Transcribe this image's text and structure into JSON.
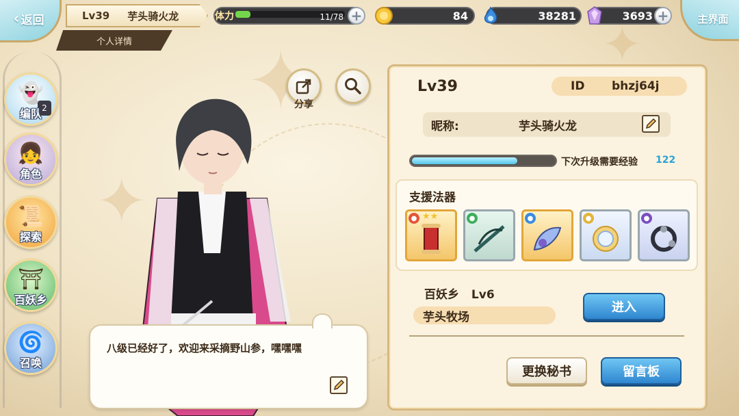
{
  "header": {
    "back_label": "返回",
    "level": "Lv39",
    "player_name": "芋头骑火龙",
    "detail_tab": "个人详情",
    "stamina_label": "体力",
    "stamina_text": "11/78",
    "stamina_fraction": 0.14,
    "coins": "84",
    "spirit": "38281",
    "gems": "3693",
    "main_label": "主界面"
  },
  "sidebar": {
    "items": [
      {
        "label": "编队",
        "badge": "2",
        "icon": "team-icon"
      },
      {
        "label": "角色",
        "icon": "character-icon"
      },
      {
        "label": "探索",
        "icon": "explore-icon"
      },
      {
        "label": "百妖乡",
        "icon": "village-icon"
      },
      {
        "label": "召唤",
        "icon": "summon-icon"
      }
    ]
  },
  "tools": {
    "share_label": "分享"
  },
  "bubble": {
    "message": "八级已经好了，欢迎来采摘野山参，嘿嘿嘿"
  },
  "profile": {
    "level": "Lv39",
    "id_label": "ID",
    "id_value": "bhzj64j",
    "nickname_label": "昵称:",
    "nickname": "芋头骑火龙",
    "exp_label": "下次升级需要经验",
    "exp_value": "122",
    "exp_fraction": 0.74,
    "support_title": "支援法器",
    "support_items": [
      {
        "element": "fire",
        "icon": "scroll-icon",
        "stars": "★★"
      },
      {
        "element": "wind",
        "icon": "bow-icon"
      },
      {
        "element": "water",
        "icon": "fan-blade-icon"
      },
      {
        "element": "light",
        "icon": "mirror-icon"
      },
      {
        "element": "dark",
        "icon": "bracelet-icon"
      }
    ],
    "village_name": "百妖乡",
    "village_level": "Lv6",
    "ranch_name": "芋头牧场",
    "enter_label": "进入",
    "change_secretary_label": "更换秘书",
    "message_board_label": "留言板"
  },
  "colors": {
    "accent_blue": "#2f86d0",
    "exp_value": "#29a3d6",
    "stamina_green": "#73d64a"
  }
}
